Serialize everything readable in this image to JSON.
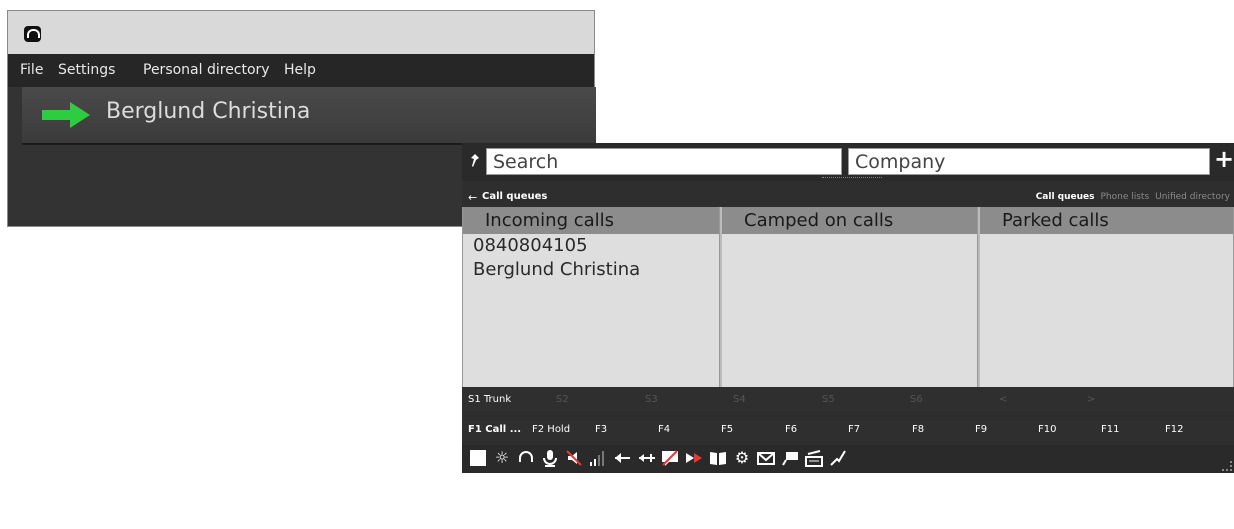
{
  "menu": [
    "File",
    "Settings",
    "Personal directory",
    "Help"
  ],
  "caller": {
    "name": "Berglund Christina"
  },
  "search": {
    "placeholder": "Search",
    "company_placeholder": "Company"
  },
  "subheader": {
    "title": "Call queues",
    "tabs": [
      "Call queues",
      "Phone lists",
      "Unified directory"
    ]
  },
  "queues": {
    "incoming": {
      "title": "Incoming calls",
      "lines": [
        "0840804105",
        "Berglund Christina"
      ]
    },
    "camped": {
      "title": "Camped on calls"
    },
    "parked": {
      "title": "Parked calls"
    }
  },
  "slots": [
    "S1 Trunk",
    "S2",
    "S3",
    "S4",
    "S5",
    "S6",
    "<",
    ">"
  ],
  "fkeys": [
    "F1 Call ...",
    "F2 Hold",
    "F3",
    "F4",
    "F5",
    "F6",
    "F7",
    "F8",
    "F9",
    "F10",
    "F11",
    "F12"
  ],
  "colors": {
    "accent_arrow": "#2ecc40",
    "window_bg": "#2e2e2e",
    "queue_header": "#8c8c8c",
    "queue_body": "#dedede"
  },
  "toolbar_icons": [
    "square-icon",
    "brightness-icon",
    "headset-icon",
    "microphone-icon",
    "speaker-mute-icon",
    "signal-icon",
    "transfer-icon",
    "conference-icon",
    "no-message-icon",
    "forward-icon",
    "book-icon",
    "settings-icon",
    "mail-icon",
    "chat-icon",
    "keyboard-icon",
    "line-icon"
  ]
}
